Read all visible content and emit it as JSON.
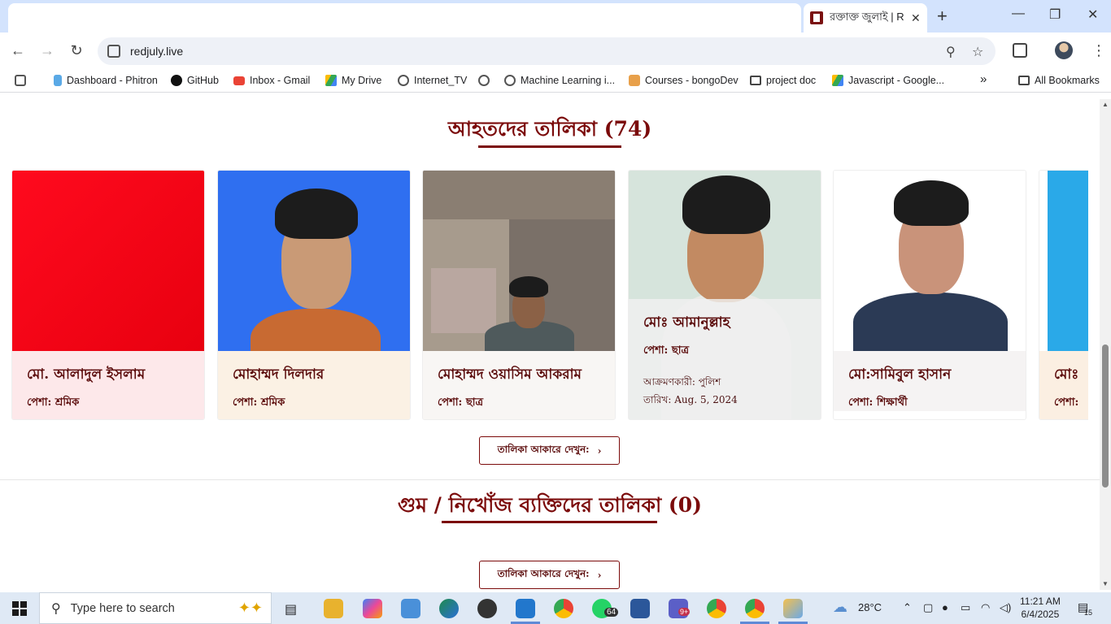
{
  "browser": {
    "tab_title": "রক্তাক্ত জুলাই | Red July",
    "url": "redjuly.live",
    "bookmarks": [
      "Dashboard - Phitron",
      "GitHub",
      "Inbox - Gmail",
      "My Drive",
      "Internet_TV",
      "Machine Learning i...",
      "Courses - bongoDev",
      "project doc",
      "Javascript - Google..."
    ],
    "all_bookmarks": "All Bookmarks",
    "more_label": "»"
  },
  "injured_section": {
    "title": "আহতদের তালিকা (74)",
    "button_label": "তালিকা আকারে দেখুন:",
    "cards": [
      {
        "name": "মো. আলাদুল ইসলাম",
        "profession": "পেশা: শ্রমিক"
      },
      {
        "name": "মোহাম্মদ দিলদার",
        "profession": "পেশা: শ্রমিক"
      },
      {
        "name": "মোহাম্মদ ওয়াসিম আকরাম",
        "profession": "পেশা: ছাত্র"
      },
      {
        "name": "মোঃ আমানুল্লাহ",
        "profession": "পেশা: ছাত্র",
        "attacker": "আক্রমণকারী: পুলিশ",
        "date": "তারিখ: Aug. 5, 2024"
      },
      {
        "name": "মো:সামিবুল হাসান",
        "profession": "পেশা: শিক্ষার্থী"
      },
      {
        "name": "মোঃ",
        "profession": "পেশা:"
      }
    ]
  },
  "missing_section": {
    "title": "গুম / নিখোঁজ ব্যক্তিদের তালিকা (0)",
    "button_label": "তালিকা আকারে দেখুন:"
  },
  "taskbar": {
    "search_placeholder": "Type here to search",
    "weather": "28°C",
    "time": "11:21 AM",
    "date": "6/4/2025",
    "whatsapp_badge": "64",
    "teams_badge": "9+",
    "notification_count": "15"
  }
}
